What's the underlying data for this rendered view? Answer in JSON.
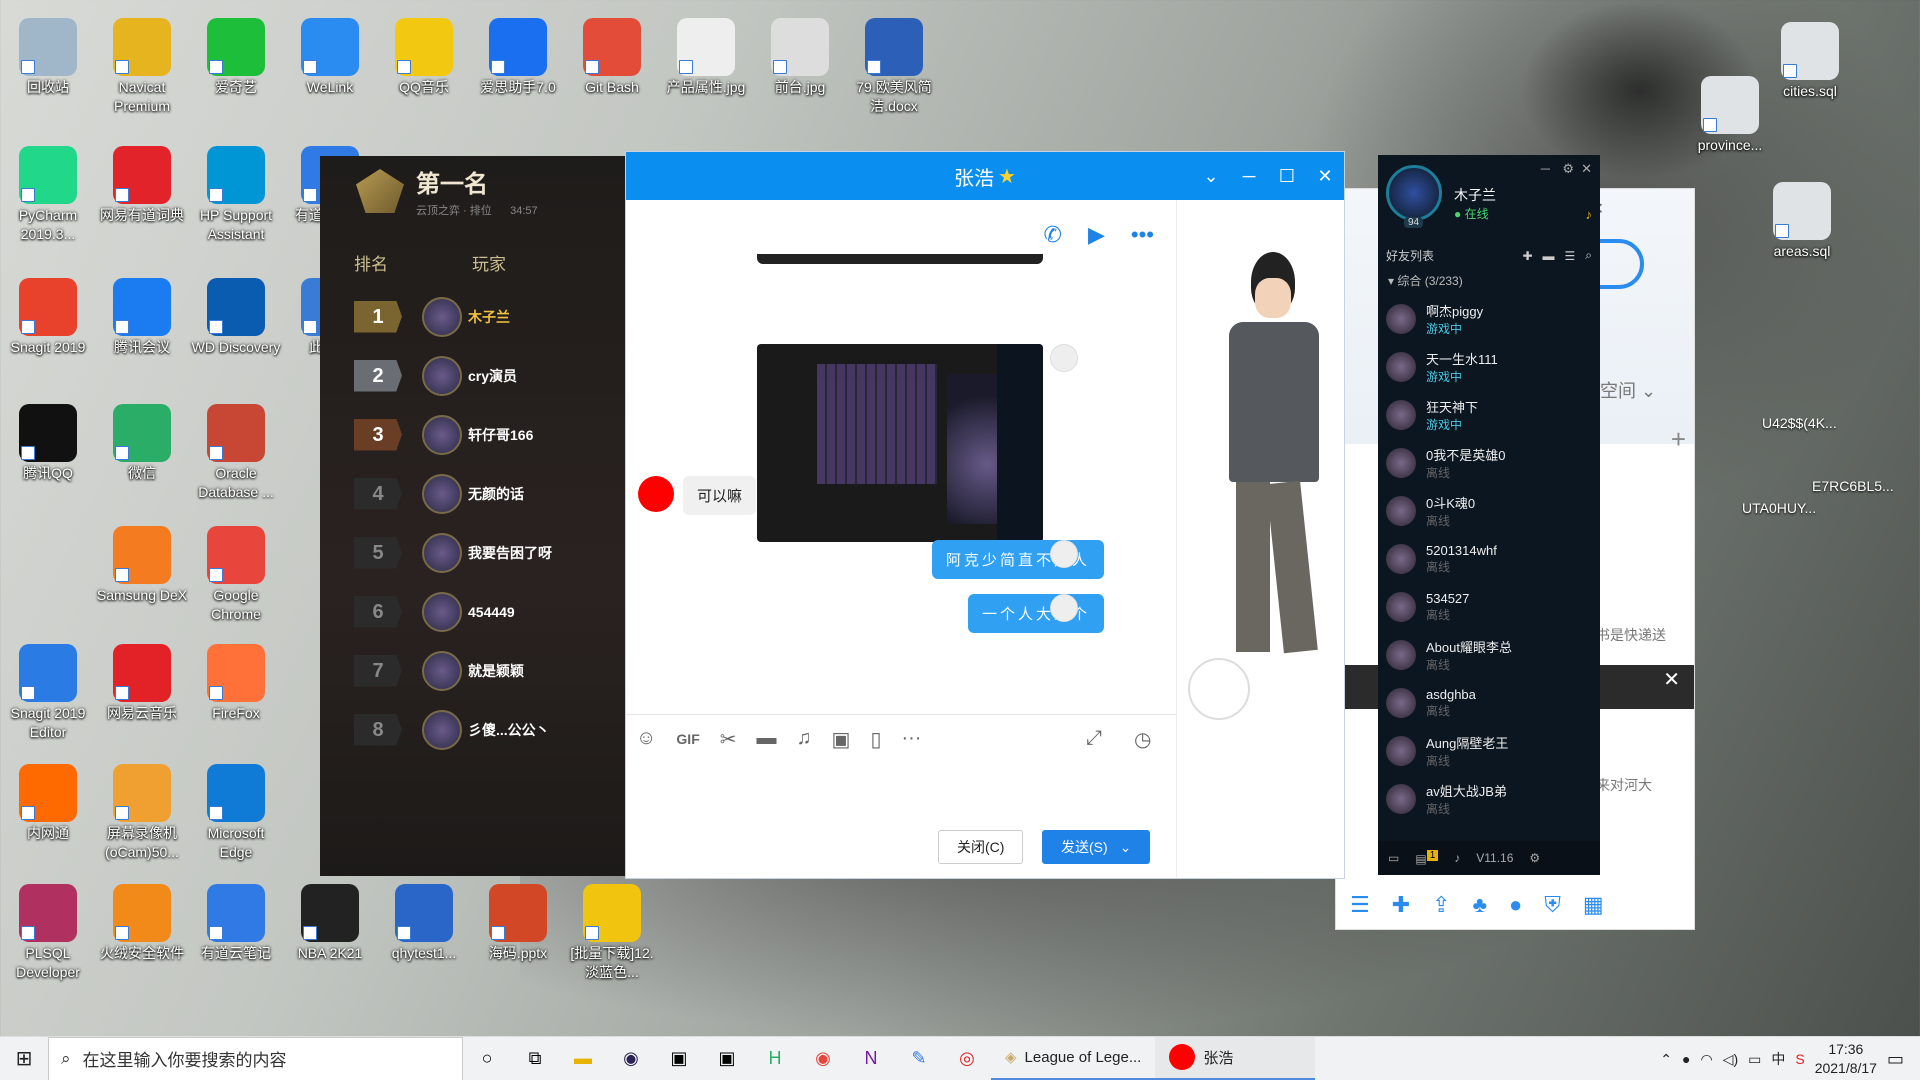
{
  "desktop": {
    "icons": [
      {
        "label": "回收站",
        "color": "#9fb7c9"
      },
      {
        "label": "Navicat Premium",
        "color": "#e6b41e"
      },
      {
        "label": "爱奇艺",
        "color": "#1dbf3a"
      },
      {
        "label": "WeLink",
        "color": "#2a8cf0"
      },
      {
        "label": "QQ音乐",
        "color": "#f2c811"
      },
      {
        "label": "爱思助手7.0",
        "color": "#1a6ef0"
      },
      {
        "label": "Git Bash",
        "color": "#e44c3a"
      },
      {
        "label": "产品属性.jpg",
        "color": "#eeeeee"
      },
      {
        "label": "前台.jpg",
        "color": "#dddddd"
      },
      {
        "label": "79.欧美风简洁.docx",
        "color": "#2b5fb8"
      },
      {
        "label": "PyCharm 2019.3...",
        "color": "#21d789"
      },
      {
        "label": "网易有道词典",
        "color": "#e2232a"
      },
      {
        "label": "HP Support Assistant",
        "color": "#0096d6"
      },
      {
        "label": "有道云笔记",
        "color": "#2f7ae5"
      },
      {
        "label": "Snagit 2019",
        "color": "#e8412c"
      },
      {
        "label": "腾讯会议",
        "color": "#1a7cf0"
      },
      {
        "label": "WD Discovery",
        "color": "#0a5cb0"
      },
      {
        "label": "此电脑",
        "color": "#3a7bd5"
      },
      {
        "label": "腾讯QQ",
        "color": "#111111"
      },
      {
        "label": "微信",
        "color": "#2aae67"
      },
      {
        "label": "Oracle Database ...",
        "color": "#c74634"
      },
      {
        "label": "Samsung DeX",
        "color": "#f47b20"
      },
      {
        "label": "Google Chrome",
        "color": "#e8453c"
      },
      {
        "label": "Snagit 2019 Editor",
        "color": "#2a7be4"
      },
      {
        "label": "网易云音乐",
        "color": "#e32227"
      },
      {
        "label": "FireFox",
        "color": "#ff7139"
      },
      {
        "label": "内网通",
        "color": "#ff6a00"
      },
      {
        "label": "屏幕录像机(oCam)50...",
        "color": "#f0a030"
      },
      {
        "label": "Microsoft Edge",
        "color": "#0f7bd6"
      },
      {
        "label": "PLSQL Developer",
        "color": "#b03060"
      },
      {
        "label": "火绒安全软件",
        "color": "#f28a1a"
      },
      {
        "label": "有道云笔记",
        "color": "#2f7ae5"
      },
      {
        "label": "NBA 2K21",
        "color": "#222222"
      },
      {
        "label": "qhytest1...",
        "color": "#2a66c8"
      },
      {
        "label": "海码.pptx",
        "color": "#d24726"
      },
      {
        "label": "[批量下载]12.淡蓝色...",
        "color": "#f1c40f"
      }
    ],
    "right_icons": [
      {
        "label": "cities.sql"
      },
      {
        "label": "province..."
      },
      {
        "label": "areas.sql"
      }
    ]
  },
  "lol": {
    "title": "第一名",
    "subtitle": "云顶之弈",
    "rank_label": "排位",
    "time": "34:57",
    "col_rank": "排名",
    "col_player": "玩家",
    "rows": [
      {
        "rank": "1",
        "name": "木子兰"
      },
      {
        "rank": "2",
        "name": "cry演员"
      },
      {
        "rank": "3",
        "name": "轩仔哥166"
      },
      {
        "rank": "4",
        "name": "无颜的话"
      },
      {
        "rank": "5",
        "name": "我要告困了呀"
      },
      {
        "rank": "6",
        "name": "454449"
      },
      {
        "rank": "7",
        "name": "就是颖颖"
      },
      {
        "rank": "8",
        "name": "彡傻...公公丶"
      }
    ]
  },
  "chat": {
    "title": "张浩",
    "star": "★",
    "messages": [
      {
        "side": "left",
        "text": "可以嘛"
      },
      {
        "side": "right",
        "text": "阿克少简直不是人"
      },
      {
        "side": "right",
        "text": "一个人大五个"
      }
    ],
    "close_btn": "关闭(C)",
    "send_btn": "发送(S)"
  },
  "friends": {
    "user": "木子兰",
    "status": "在线",
    "level": "94",
    "list_title": "好友列表",
    "group": "综合 (3/233)",
    "version": "V11.16",
    "badge": "1",
    "items": [
      {
        "name": "啊杰piggy",
        "status": "游戏中"
      },
      {
        "name": "天一生水111",
        "status": "游戏中"
      },
      {
        "name": "狂天神下",
        "status": "游戏中"
      },
      {
        "name": "0我不是英雄0",
        "status": "离线"
      },
      {
        "name": "0斗K魂0",
        "status": "离线"
      },
      {
        "name": "5201314whf",
        "status": "离线"
      },
      {
        "name": "534527",
        "status": "离线"
      },
      {
        "name": "About耀眼李总",
        "status": "离线"
      },
      {
        "name": "asdghba",
        "status": "离线"
      },
      {
        "name": "Aung隔壁老王",
        "status": "离线"
      },
      {
        "name": "av姐大战JB弟",
        "status": "离线"
      }
    ]
  },
  "side": {
    "space": "空间",
    "text1": "书是快递送",
    "text2": "来对河大",
    "text3": "U42$$(4K...",
    "text4": "E7RC6BL5...",
    "text5": "UTA0HUY..."
  },
  "taskbar": {
    "search_placeholder": "在这里输入你要搜索的内容",
    "lol_app": "League of Lege...",
    "qq_app": "张浩",
    "time": "17:36",
    "date": "2021/8/17",
    "ime": "中"
  }
}
